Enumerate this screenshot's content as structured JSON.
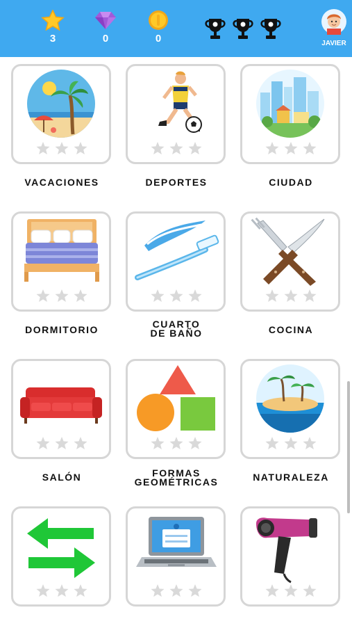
{
  "header": {
    "stars_count": "3",
    "gems_count": "0",
    "coins_count": "0",
    "user_name": "JAVIER"
  },
  "categories": [
    {
      "label": "VACACIONES",
      "icon": "beach-icon",
      "stars_earned": 0
    },
    {
      "label": "DEPORTES",
      "icon": "soccer-player-icon",
      "stars_earned": 0
    },
    {
      "label": "CIUDAD",
      "icon": "city-icon",
      "stars_earned": 0
    },
    {
      "label": "DORMITORIO",
      "icon": "bed-icon",
      "stars_earned": 0
    },
    {
      "label_line1": "CUARTO",
      "label_line2": "DE BAÑO",
      "icon": "toothbrush-icon",
      "stars_earned": 0
    },
    {
      "label": "COCINA",
      "icon": "fork-knife-icon",
      "stars_earned": 0
    },
    {
      "label": "SALÓN",
      "icon": "sofa-icon",
      "stars_earned": 0
    },
    {
      "label_line1": "FORMAS",
      "label_line2": "GEOMÉTRICAS",
      "icon": "shapes-icon",
      "stars_earned": 0
    },
    {
      "label": "NATURALEZA",
      "icon": "island-icon",
      "stars_earned": 0
    },
    {
      "label": "",
      "icon": "arrows-icon",
      "stars_earned": 0
    },
    {
      "label": "",
      "icon": "laptop-icon",
      "stars_earned": 0
    },
    {
      "label": "",
      "icon": "hair-dryer-icon",
      "stars_earned": 0
    }
  ],
  "colors": {
    "header_bg": "#3fa9f0",
    "card_border": "#d6d6d6",
    "star_empty": "#d9d9d9"
  }
}
